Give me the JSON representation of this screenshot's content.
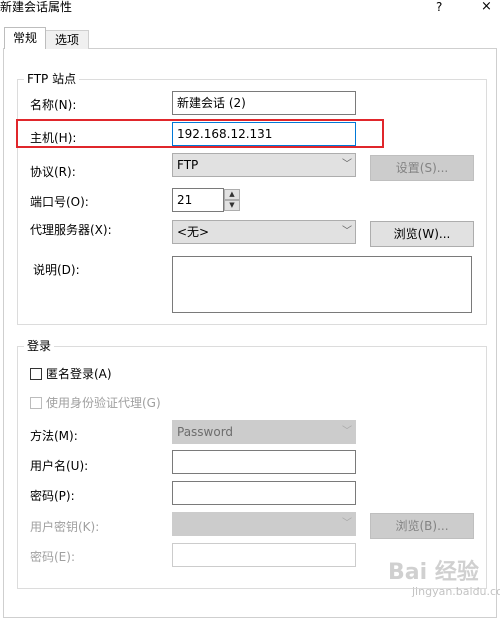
{
  "window": {
    "title": "新建会话属性",
    "help": "?",
    "close": "×"
  },
  "tabs": [
    {
      "label": "常规"
    },
    {
      "label": "选项"
    }
  ],
  "ftp_site": {
    "group_title": "FTP 站点",
    "name_label": "名称(N):",
    "name_value": "新建会话 (2)",
    "host_label": "主机(H):",
    "host_value": "192.168.12.131",
    "protocol_label": "协议(R):",
    "protocol_value": "FTP",
    "settings_button": "设置(S)...",
    "port_label": "端口号(O):",
    "port_value": "21",
    "proxy_label": "代理服务器(X):",
    "proxy_value": "<无>",
    "browse_button": "浏览(W)...",
    "description_label": "说明(D):"
  },
  "login": {
    "group_title": "登录",
    "anonymous_label": "匿名登录(A)",
    "anonymous_checked": false,
    "agent_label": "使用身份验证代理(G)",
    "method_label": "方法(M):",
    "method_value": "Password",
    "username_label": "用户名(U):",
    "password_label": "密码(P):",
    "userkey_label": "用户密钥(K):",
    "browse_button": "浏览(B)...",
    "passphrase_label": "密码(E):"
  },
  "watermark": {
    "text": "Bai 经验",
    "sub": "jingyan.baidu.com"
  },
  "colors": {
    "highlight": "#e0262b",
    "focus_border": "#0078d7"
  }
}
